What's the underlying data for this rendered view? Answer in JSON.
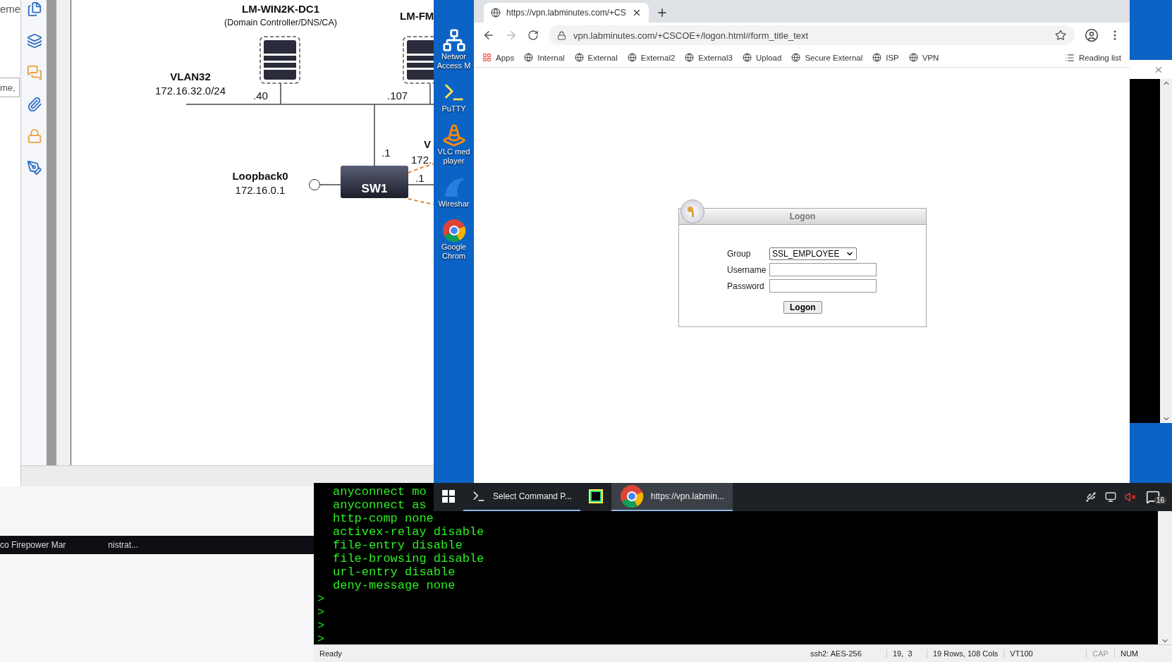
{
  "diagram_window": {
    "side_panel_text": "eme",
    "side_field_value": "me,",
    "diagram": {
      "servers": [
        {
          "name": "LM-WIN2K-DC1",
          "role": "(Domain Controller/DNS/CA)",
          "address": ".40"
        },
        {
          "name": "LM-FM",
          "address": ".107"
        }
      ],
      "vlan": {
        "name": "VLAN32",
        "subnet": "172.16.32.0/24"
      },
      "switch": {
        "name": "SW1",
        "uplink_address": ".1",
        "right_address": ".1",
        "right_vlan": "V",
        "right_subnet": "172."
      },
      "loopback": {
        "name": "Loopback0",
        "address": "172.16.0.1"
      }
    }
  },
  "desktop_icons": [
    {
      "label": "Networ Access M",
      "kind": "network"
    },
    {
      "label": "PuTTY",
      "kind": "putty"
    },
    {
      "label": "VLC med player",
      "kind": "vlc"
    },
    {
      "label": "Wireshar",
      "kind": "wireshark"
    },
    {
      "label": "Google Chrom",
      "kind": "chrome"
    }
  ],
  "browser": {
    "tab_title": "https://vpn.labminutes.com/+CS",
    "url": "vpn.labminutes.com/+CSCOE+/logon.html#form_title_text",
    "bookmarks": [
      {
        "label": "Apps",
        "kind": "apps"
      },
      {
        "label": "Internal",
        "kind": "site"
      },
      {
        "label": "External",
        "kind": "site"
      },
      {
        "label": "External2",
        "kind": "site"
      },
      {
        "label": "External3",
        "kind": "site"
      },
      {
        "label": "Upload",
        "kind": "site"
      },
      {
        "label": "Secure External",
        "kind": "site"
      },
      {
        "label": "ISP",
        "kind": "site"
      },
      {
        "label": "VPN",
        "kind": "site"
      }
    ],
    "reading_list": "Reading list",
    "logon": {
      "title": "Logon",
      "fields": [
        {
          "label": "Group",
          "kind": "select",
          "value": "SSL_EMPLOYEE"
        },
        {
          "label": "Username",
          "kind": "text"
        },
        {
          "label": "Password",
          "kind": "password"
        }
      ],
      "button": "Logon"
    }
  },
  "taskbar": {
    "items": [
      {
        "kind": "terminal",
        "label": "Select Command P...",
        "selected": false
      },
      {
        "kind": "app",
        "selected": false
      },
      {
        "kind": "browser",
        "label": "https://vpn.labmin...",
        "selected": true
      }
    ],
    "notification_count": "16"
  },
  "terminal": {
    "lines": [
      {
        "kind": "config",
        "text": "anyconnect mo"
      },
      {
        "kind": "config",
        "text": "anyconnect as"
      },
      {
        "kind": "config",
        "text": "http-comp none"
      },
      {
        "kind": "config",
        "text": "activex-relay disable"
      },
      {
        "kind": "config",
        "text": "file-entry disable"
      },
      {
        "kind": "config",
        "text": "file-browsing disable"
      },
      {
        "kind": "config",
        "text": "url-entry disable"
      },
      {
        "kind": "config",
        "text": "deny-message none"
      },
      {
        "kind": "prompt",
        "text": ">"
      },
      {
        "kind": "prompt",
        "text": ">"
      },
      {
        "kind": "prompt",
        "text": ">"
      },
      {
        "kind": "prompt",
        "text": ">"
      }
    ],
    "status": {
      "state": "Ready",
      "cipher": "ssh2: AES-256",
      "position": "19,  3",
      "size": "19 Rows, 108 Cols",
      "emulation": "VT100",
      "indicators": [
        {
          "label": "CAP",
          "on": false
        },
        {
          "label": "NUM",
          "on": true
        }
      ]
    }
  },
  "background_taskbar": {
    "items": [
      "co Firepower Mar",
      "nistrat..."
    ]
  }
}
